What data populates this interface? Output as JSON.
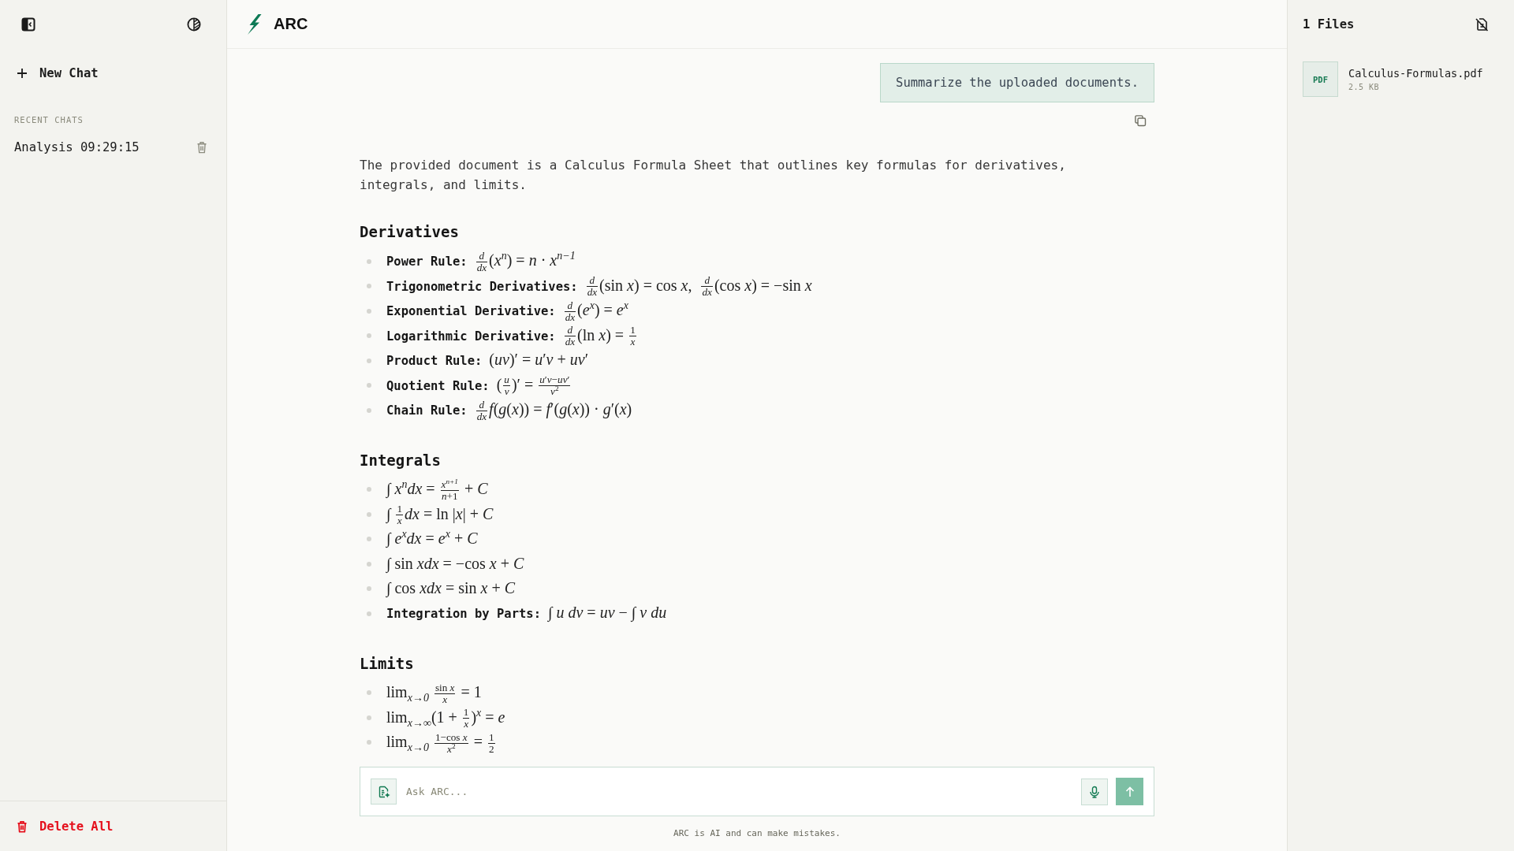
{
  "sidebar": {
    "new_chat": "New Chat",
    "section_title": "RECENT CHATS",
    "chats": [
      {
        "title": "Analysis 09:29:15",
        "selected": false
      }
    ],
    "delete_all": "Delete All"
  },
  "header": {
    "title": "ARC"
  },
  "conversation": {
    "user_message": "Summarize the uploaded documents.",
    "answer": {
      "intro": "The provided document is a Calculus Formula Sheet that outlines key formulas for derivatives, integrals, and limits.",
      "sections": [
        {
          "heading": "Derivatives",
          "items": [
            {
              "label": "Power Rule:",
              "formula": [
                {
                  "kind": "frac",
                  "num": "*d*",
                  "den": "*dx*"
                },
                {
                  "kind": "text",
                  "text": "(*x*$^{n}$) = *n* · *x*$^{n−1}$"
                }
              ]
            },
            {
              "label": "Trigonometric Derivatives:",
              "formula": [
                {
                  "kind": "frac",
                  "num": "*d*",
                  "den": "*dx*"
                },
                {
                  "kind": "text",
                  "text": "(sin *x*) = cos *x*,  "
                },
                {
                  "kind": "frac",
                  "num": "*d*",
                  "den": "*dx*"
                },
                {
                  "kind": "text",
                  "text": "(cos *x*) = −sin *x*"
                }
              ]
            },
            {
              "label": "Exponential Derivative:",
              "formula": [
                {
                  "kind": "frac",
                  "num": "*d*",
                  "den": "*dx*"
                },
                {
                  "kind": "text",
                  "text": "(*e*$^{x}$) = *e*$^{x}$"
                }
              ]
            },
            {
              "label": "Logarithmic Derivative:",
              "formula": [
                {
                  "kind": "frac",
                  "num": "*d*",
                  "den": "*dx*"
                },
                {
                  "kind": "text",
                  "text": "(ln *x*) = "
                },
                {
                  "kind": "frac",
                  "num": "1",
                  "den": "*x*"
                }
              ]
            },
            {
              "label": "Product Rule:",
              "formula": [
                {
                  "kind": "text",
                  "text": "(*uv*)′ = *u*′*v* + *uv*′"
                }
              ]
            },
            {
              "label": "Quotient Rule:",
              "formula": [
                {
                  "kind": "text",
                  "text": "("
                },
                {
                  "kind": "frac",
                  "num": "*u*",
                  "den": "*v*"
                },
                {
                  "kind": "text",
                  "text": ")′ = "
                },
                {
                  "kind": "frac",
                  "num": "*u*′*v*−*uv*′",
                  "den": "*v*$^{2}$"
                }
              ]
            },
            {
              "label": "Chain Rule:",
              "formula": [
                {
                  "kind": "frac",
                  "num": "*d*",
                  "den": "*dx*"
                },
                {
                  "kind": "text",
                  "text": "*f*(*g*(*x*)) = *f*′(*g*(*x*)) · *g*′(*x*)"
                }
              ]
            }
          ]
        },
        {
          "heading": "Integrals",
          "items": [
            {
              "formula": [
                {
                  "kind": "text",
                  "text": "∫ *x*$^{n}$*dx* = "
                },
                {
                  "kind": "frac",
                  "num": "*x*$^{n+1}$",
                  "den": "*n*+1"
                },
                {
                  "kind": "text",
                  "text": " + *C*"
                }
              ]
            },
            {
              "formula": [
                {
                  "kind": "text",
                  "text": "∫ "
                },
                {
                  "kind": "frac",
                  "num": "1",
                  "den": "*x*"
                },
                {
                  "kind": "text",
                  "text": "*dx* = ln |*x*| + *C*"
                }
              ]
            },
            {
              "formula": [
                {
                  "kind": "text",
                  "text": "∫ *e*$^{x}$*dx* = *e*$^{x}$ + *C*"
                }
              ]
            },
            {
              "formula": [
                {
                  "kind": "text",
                  "text": "∫ sin *xdx* = −cos *x* + *C*"
                }
              ]
            },
            {
              "formula": [
                {
                  "kind": "text",
                  "text": "∫ cos *xdx* = sin *x* + *C*"
                }
              ]
            },
            {
              "label": "Integration by Parts:",
              "formula": [
                {
                  "kind": "text",
                  "text": "∫ *u dv* = *uv* − ∫ *v du*"
                }
              ]
            }
          ]
        },
        {
          "heading": "Limits",
          "items": [
            {
              "formula": [
                {
                  "kind": "text",
                  "text": "lim$_{x→0}$ "
                },
                {
                  "kind": "frac",
                  "num": "sin *x*",
                  "den": "*x*"
                },
                {
                  "kind": "text",
                  "text": " = 1"
                }
              ]
            },
            {
              "formula": [
                {
                  "kind": "text",
                  "text": "lim$_{x→∞}$(1 + "
                },
                {
                  "kind": "frac",
                  "num": "1",
                  "den": "*x*"
                },
                {
                  "kind": "text",
                  "text": ")$^{x}$ = *e*"
                }
              ]
            },
            {
              "formula": [
                {
                  "kind": "text",
                  "text": "lim$_{x→0}$ "
                },
                {
                  "kind": "frac",
                  "num": "1−cos *x*",
                  "den": "*x*$^{2}$"
                },
                {
                  "kind": "text",
                  "text": " = "
                },
                {
                  "kind": "frac",
                  "num": "1",
                  "den": "2"
                }
              ]
            }
          ]
        }
      ]
    }
  },
  "composer": {
    "placeholder": "Ask ARC...",
    "disclaimer": "ARC is AI and can make mistakes."
  },
  "files_panel": {
    "title": "1 Files",
    "files": [
      {
        "type": "PDF",
        "name": "Calculus-Formulas.pdf",
        "size": "2.5 KB"
      }
    ]
  }
}
